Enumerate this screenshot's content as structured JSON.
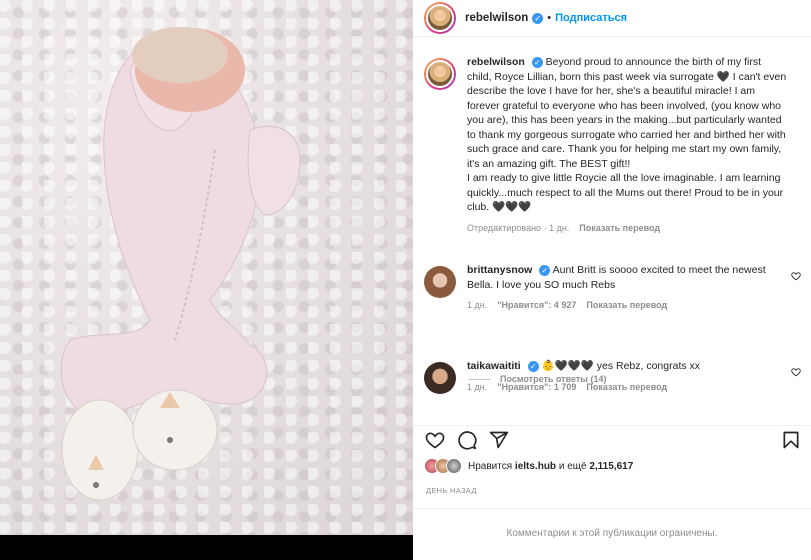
{
  "post": {
    "author": "rebelwilson",
    "follow_label": "Подписаться",
    "caption": "Beyond proud to announce the birth of my first child, Royce Lillian, born this past week via surrogate 🖤 I can't even describe the love I have for her, she's a beautiful miracle! I am forever grateful to everyone who has been involved, (you know who you are), this has been years in the making...but particularly wanted to thank my gorgeous surrogate who carried her and birthed her with such grace and care. Thank you for helping me start my own family, it's an amazing gift. The BEST gift!!",
    "caption_2": "I am ready to give little Roycie all the love imaginable. I am learning quickly...much respect to all the Mums out there! Proud to be in your club. 🖤🖤🖤",
    "edited": "Отредактировано",
    "age": "1 дн.",
    "translate": "Показать перевод"
  },
  "comments": [
    {
      "user": "brittanysnow",
      "text": "Aunt Britt is soooo excited to meet the newest Bella. I love you SO much Rebs",
      "age": "1 дн.",
      "likes": "\"Нравится\": 4 927",
      "translate": "Показать перевод",
      "replies": "Посмотреть ответы (14)"
    },
    {
      "user": "taikawaititi",
      "text": "👶🖤🖤🖤 yes Rebz, congrats xx",
      "age": "1 дн.",
      "likes": "\"Нравится\": 1 709",
      "translate": "Показать перевод"
    }
  ],
  "likes_summary": {
    "prefix": "Нравится",
    "user": "ielts.hub",
    "middle": "и ещё",
    "count": "2,115,617"
  },
  "timestamp": "ДЕНЬ НАЗАД",
  "comments_restricted": "Комментарии к этой публикации ограничены.",
  "icons": [
    "heart-icon",
    "comment-icon",
    "share-icon",
    "bookmark-icon",
    "verified-badge-icon"
  ],
  "colors": {
    "accent": "#0095f6",
    "verified": "#3897f0",
    "muted": "#8e8e8e"
  }
}
